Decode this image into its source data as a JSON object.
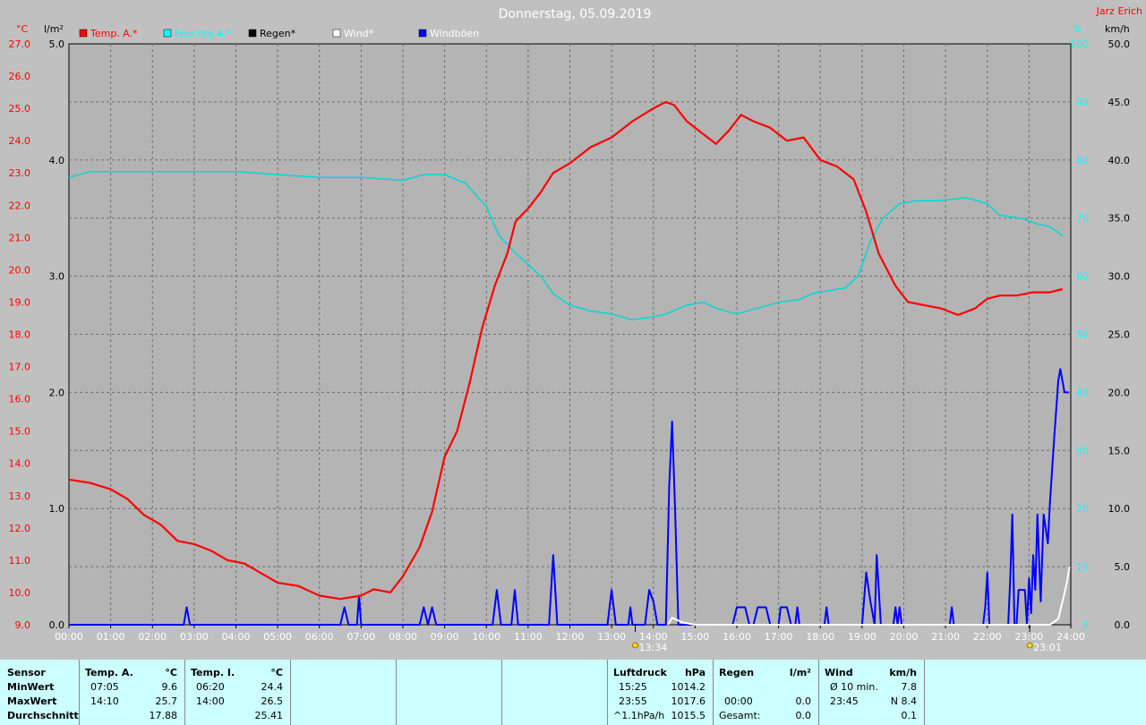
{
  "header": {
    "title": "Donnerstag, 05.09.2019",
    "author": "Jarz Erich"
  },
  "colors": {
    "temp": "#ff0000",
    "humidity": "#00d8d8",
    "rain": "#000000",
    "wind": "#ffffff",
    "gust": "#0000ff",
    "plot_bg": "#b4b4b4",
    "panel_bg": "#ccffff"
  },
  "axis_units": {
    "temp": "°C",
    "rain": "l/m²",
    "humidity": "%",
    "wind": "km/h"
  },
  "legend": [
    {
      "label": "Temp. A.*",
      "color": "#ff0000"
    },
    {
      "label": "Feuchte A.*",
      "color": "#00ffff"
    },
    {
      "label": "Regen*",
      "color": "#000000"
    },
    {
      "label": "Wind*",
      "color": "#ffffff"
    },
    {
      "label": "Windböen",
      "color": "#0000ff"
    }
  ],
  "markers": [
    {
      "label": "13:34",
      "symbol": "sun-rise-icon"
    },
    {
      "label": "23:01",
      "symbol": "sun-set-icon"
    }
  ],
  "chart_data": {
    "type": "line",
    "x_labels": [
      "00:00",
      "01:00",
      "02:00",
      "03:00",
      "04:00",
      "05:00",
      "06:00",
      "07:00",
      "08:00",
      "09:00",
      "10:00",
      "11:00",
      "12:00",
      "13:00",
      "14:00",
      "15:00",
      "16:00",
      "17:00",
      "18:00",
      "19:00",
      "20:00",
      "21:00",
      "22:00",
      "23:00",
      "24:00"
    ],
    "xlim": [
      0,
      24
    ],
    "axes": {
      "temp": {
        "ylim": [
          9,
          27
        ],
        "ticks": [
          "9.0",
          "10.0",
          "11.0",
          "12.0",
          "13.0",
          "14.0",
          "15.0",
          "16.0",
          "17.0",
          "18.0",
          "19.0",
          "20.0",
          "21.0",
          "22.0",
          "23.0",
          "24.0",
          "25.0",
          "26.0",
          "27.0"
        ]
      },
      "rain": {
        "ylim": [
          0,
          5
        ],
        "ticks": [
          "0.0",
          "1.0",
          "2.0",
          "3.0",
          "4.0",
          "5.0"
        ]
      },
      "humidity": {
        "ylim": [
          0,
          100
        ],
        "ticks": [
          "0",
          "10",
          "20",
          "30",
          "40",
          "50",
          "60",
          "70",
          "80",
          "90",
          "100"
        ]
      },
      "wind": {
        "ylim": [
          0,
          50
        ],
        "ticks": [
          "0.0",
          "5.0",
          "10.0",
          "15.0",
          "20.0",
          "25.0",
          "30.0",
          "35.0",
          "40.0",
          "45.0",
          "50.0"
        ]
      }
    },
    "series": [
      {
        "name": "Temp. A.*",
        "axis": "temp",
        "points": [
          [
            0,
            13.5
          ],
          [
            0.5,
            13.4
          ],
          [
            1,
            13.2
          ],
          [
            1.4,
            12.9
          ],
          [
            1.8,
            12.4
          ],
          [
            2.2,
            12.1
          ],
          [
            2.6,
            11.6
          ],
          [
            3,
            11.5
          ],
          [
            3.4,
            11.3
          ],
          [
            3.8,
            11.0
          ],
          [
            4.2,
            10.9
          ],
          [
            4.6,
            10.6
          ],
          [
            5,
            10.3
          ],
          [
            5.5,
            10.2
          ],
          [
            6,
            9.9
          ],
          [
            6.5,
            9.8
          ],
          [
            7,
            9.9
          ],
          [
            7.3,
            10.1
          ],
          [
            7.7,
            10.0
          ],
          [
            8,
            10.5
          ],
          [
            8.4,
            11.4
          ],
          [
            8.7,
            12.5
          ],
          [
            9,
            14.2
          ],
          [
            9.3,
            15.0
          ],
          [
            9.6,
            16.5
          ],
          [
            9.9,
            18.2
          ],
          [
            10.2,
            19.5
          ],
          [
            10.5,
            20.5
          ],
          [
            10.7,
            21.5
          ],
          [
            11,
            21.9
          ],
          [
            11.3,
            22.4
          ],
          [
            11.6,
            23.0
          ],
          [
            12,
            23.3
          ],
          [
            12.5,
            23.8
          ],
          [
            13,
            24.1
          ],
          [
            13.5,
            24.6
          ],
          [
            14,
            25.0
          ],
          [
            14.3,
            25.2
          ],
          [
            14.5,
            25.1
          ],
          [
            14.8,
            24.6
          ],
          [
            15.2,
            24.2
          ],
          [
            15.5,
            23.9
          ],
          [
            15.8,
            24.3
          ],
          [
            16.1,
            24.8
          ],
          [
            16.4,
            24.6
          ],
          [
            16.8,
            24.4
          ],
          [
            17.2,
            24.0
          ],
          [
            17.6,
            24.1
          ],
          [
            18,
            23.4
          ],
          [
            18.4,
            23.2
          ],
          [
            18.8,
            22.8
          ],
          [
            19.1,
            21.8
          ],
          [
            19.4,
            20.5
          ],
          [
            19.8,
            19.5
          ],
          [
            20.1,
            19.0
          ],
          [
            20.5,
            18.9
          ],
          [
            20.9,
            18.8
          ],
          [
            21.3,
            18.6
          ],
          [
            21.7,
            18.8
          ],
          [
            22,
            19.1
          ],
          [
            22.3,
            19.2
          ],
          [
            22.7,
            19.2
          ],
          [
            23.1,
            19.3
          ],
          [
            23.5,
            19.3
          ],
          [
            23.8,
            19.4
          ]
        ]
      },
      {
        "name": "Feuchte A.*",
        "axis": "humidity",
        "points": [
          [
            0,
            77
          ],
          [
            0.5,
            78
          ],
          [
            1,
            78
          ],
          [
            2,
            78
          ],
          [
            3,
            78
          ],
          [
            4,
            78
          ],
          [
            5,
            77.5
          ],
          [
            6,
            77
          ],
          [
            7,
            77
          ],
          [
            8,
            76.5
          ],
          [
            8.5,
            77.5
          ],
          [
            9,
            77.5
          ],
          [
            9.5,
            76
          ],
          [
            10,
            72
          ],
          [
            10.3,
            67
          ],
          [
            10.7,
            64
          ],
          [
            11,
            62
          ],
          [
            11.3,
            60
          ],
          [
            11.6,
            57
          ],
          [
            12,
            55
          ],
          [
            12.5,
            54
          ],
          [
            13,
            53.5
          ],
          [
            13.5,
            52.5
          ],
          [
            14,
            53
          ],
          [
            14.3,
            53.5
          ],
          [
            14.8,
            55
          ],
          [
            15.2,
            55.5
          ],
          [
            15.5,
            54.5
          ],
          [
            16,
            53.5
          ],
          [
            16.5,
            54.5
          ],
          [
            17,
            55.5
          ],
          [
            17.5,
            56
          ],
          [
            17.8,
            57
          ],
          [
            18.2,
            57.5
          ],
          [
            18.6,
            58
          ],
          [
            18.9,
            60
          ],
          [
            19.2,
            66
          ],
          [
            19.5,
            70
          ],
          [
            19.9,
            72.5
          ],
          [
            20.3,
            73
          ],
          [
            20.8,
            73
          ],
          [
            21.5,
            73.5
          ],
          [
            22,
            72.5
          ],
          [
            22.3,
            70.5
          ],
          [
            22.8,
            70
          ],
          [
            23.2,
            69
          ],
          [
            23.5,
            68.5
          ],
          [
            23.8,
            67
          ]
        ]
      },
      {
        "name": "Windböen",
        "axis": "wind",
        "points": [
          [
            0,
            0
          ],
          [
            2.75,
            0
          ],
          [
            2.82,
            1.5
          ],
          [
            2.9,
            0
          ],
          [
            6.5,
            0
          ],
          [
            6.6,
            1.5
          ],
          [
            6.7,
            0
          ],
          [
            6.9,
            0
          ],
          [
            6.95,
            2.5
          ],
          [
            7,
            0
          ],
          [
            8.4,
            0
          ],
          [
            8.5,
            1.5
          ],
          [
            8.6,
            0
          ],
          [
            8.7,
            1.5
          ],
          [
            8.8,
            0
          ],
          [
            10.15,
            0
          ],
          [
            10.25,
            3.0
          ],
          [
            10.35,
            0
          ],
          [
            10.6,
            0
          ],
          [
            10.68,
            3.0
          ],
          [
            10.76,
            0
          ],
          [
            11.5,
            0
          ],
          [
            11.6,
            6.0
          ],
          [
            11.7,
            0
          ],
          [
            12.9,
            0
          ],
          [
            13.0,
            3.0
          ],
          [
            13.1,
            0
          ],
          [
            13.4,
            0
          ],
          [
            13.45,
            1.5
          ],
          [
            13.5,
            0
          ],
          [
            13.8,
            0
          ],
          [
            13.9,
            3.0
          ],
          [
            14.0,
            2.0
          ],
          [
            14.1,
            0
          ],
          [
            14.3,
            0
          ],
          [
            14.38,
            12.0
          ],
          [
            14.45,
            17.5
          ],
          [
            14.52,
            10.0
          ],
          [
            14.6,
            0
          ],
          [
            15.9,
            0
          ],
          [
            16.0,
            1.5
          ],
          [
            16.2,
            1.5
          ],
          [
            16.3,
            0
          ],
          [
            16.4,
            0
          ],
          [
            16.5,
            1.5
          ],
          [
            16.7,
            1.5
          ],
          [
            16.8,
            0
          ],
          [
            17.0,
            0
          ],
          [
            17.05,
            1.5
          ],
          [
            17.2,
            1.5
          ],
          [
            17.3,
            0
          ],
          [
            17.4,
            0
          ],
          [
            17.45,
            1.5
          ],
          [
            17.5,
            0
          ],
          [
            18.1,
            0
          ],
          [
            18.15,
            1.5
          ],
          [
            18.2,
            0
          ],
          [
            19.0,
            0
          ],
          [
            19.1,
            4.5
          ],
          [
            19.2,
            2.0
          ],
          [
            19.3,
            0
          ],
          [
            19.35,
            6.0
          ],
          [
            19.45,
            0
          ],
          [
            19.75,
            0
          ],
          [
            19.8,
            1.5
          ],
          [
            19.85,
            0
          ],
          [
            19.9,
            1.5
          ],
          [
            19.95,
            0
          ],
          [
            21.1,
            0
          ],
          [
            21.15,
            1.5
          ],
          [
            21.2,
            0
          ],
          [
            21.9,
            0
          ],
          [
            21.95,
            1.5
          ],
          [
            22.0,
            4.5
          ],
          [
            22.05,
            0
          ],
          [
            22.5,
            0
          ],
          [
            22.55,
            4.0
          ],
          [
            22.6,
            9.5
          ],
          [
            22.65,
            0
          ],
          [
            22.7,
            0
          ],
          [
            22.75,
            3.0
          ],
          [
            22.8,
            3.0
          ],
          [
            22.9,
            3.0
          ],
          [
            22.95,
            0
          ],
          [
            23.0,
            4.0
          ],
          [
            23.05,
            1.0
          ],
          [
            23.1,
            6.0
          ],
          [
            23.15,
            3.0
          ],
          [
            23.2,
            9.5
          ],
          [
            23.28,
            2.0
          ],
          [
            23.35,
            9.5
          ],
          [
            23.45,
            7.0
          ],
          [
            23.5,
            10.5
          ],
          [
            23.6,
            16.0
          ],
          [
            23.7,
            21.0
          ],
          [
            23.75,
            22.0
          ],
          [
            23.85,
            20.0
          ],
          [
            23.95,
            20.0
          ]
        ]
      },
      {
        "name": "Wind*",
        "axis": "wind",
        "points": [
          [
            14.35,
            0
          ],
          [
            14.45,
            0.6
          ],
          [
            14.7,
            0.2
          ],
          [
            15.0,
            0
          ],
          [
            23.2,
            0
          ],
          [
            23.5,
            0
          ],
          [
            23.7,
            0.5
          ],
          [
            23.8,
            2.0
          ],
          [
            23.9,
            3.5
          ],
          [
            23.97,
            5.0
          ]
        ]
      },
      {
        "name": "Regen*",
        "axis": "rain",
        "points": [
          [
            0,
            0
          ],
          [
            24,
            0
          ]
        ]
      }
    ]
  },
  "table": {
    "sensor": {
      "header": "Sensor",
      "rows": [
        "MinWert",
        "MaxWert",
        "Durchschnitt"
      ]
    },
    "temp_a": {
      "header": "Temp. A.",
      "unit": "°C",
      "min_time": "07:05",
      "min_val": "9.6",
      "max_time": "14:10",
      "max_val": "25.7",
      "avg": "17.88"
    },
    "temp_i": {
      "header": "Temp. I.",
      "unit": "°C",
      "min_time": "06:20",
      "min_val": "24.4",
      "max_time": "14:00",
      "max_val": "26.5",
      "avg": "25.41"
    },
    "pressure": {
      "header": "Luftdruck",
      "unit": "hPa",
      "min_time": "15:25",
      "min_val": "1014.2",
      "max_time": "23:55",
      "max_val": "1017.6",
      "trend": "^1.1hPa/h",
      "trend_val": "1015.5"
    },
    "rain": {
      "header": "Regen",
      "unit": "l/m²",
      "max_time": "00:00",
      "max_val": "0.0",
      "total_label": "Gesamt:",
      "total_val": "0.0"
    },
    "wind": {
      "header": "Wind",
      "unit": "km/h",
      "min_label": "Ø 10 min.",
      "min_val": "7.8",
      "max_time": "23:45",
      "max_val": "N 8.4",
      "avg": "0.1"
    }
  }
}
